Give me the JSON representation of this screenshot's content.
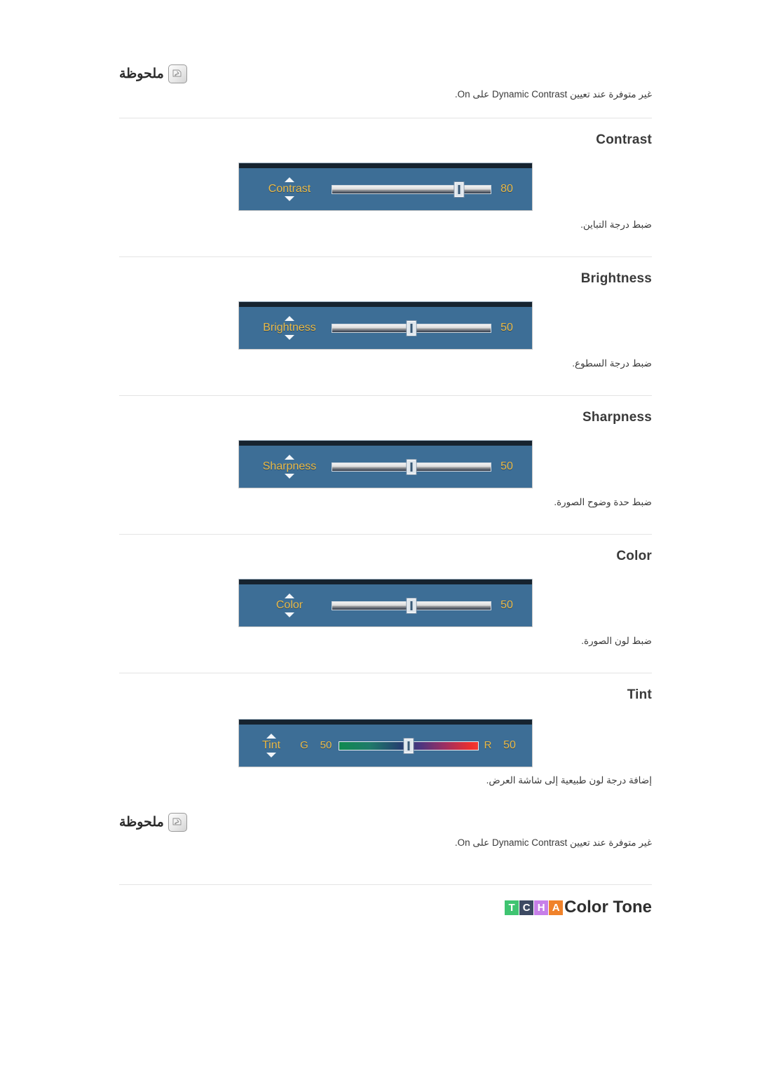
{
  "note_top": {
    "icon": "note-pencil-icon",
    "title": "ملحوظة",
    "body_prefix": ".",
    "body": "غير متوفرة عند تعيين Dynamic Contrast على On.",
    "emphasis": "Dynamic Contrast",
    "emphasis2": "On"
  },
  "sections": [
    {
      "heading": "Contrast",
      "osd": {
        "label": "Contrast",
        "value": "80",
        "thumb_percent": 80,
        "gradient": false,
        "left_text": "",
        "left_value": "",
        "right_text": "",
        "right_value": ""
      },
      "caption": "ضبط درجة التباين."
    },
    {
      "heading": "Brightness",
      "osd": {
        "label": "Brightness",
        "value": "50",
        "thumb_percent": 50,
        "gradient": false,
        "left_text": "",
        "left_value": "",
        "right_text": "",
        "right_value": ""
      },
      "caption": "ضبط درجة السطوع."
    },
    {
      "heading": "Sharpness",
      "osd": {
        "label": "Sharpness",
        "value": "50",
        "thumb_percent": 50,
        "gradient": false,
        "left_text": "",
        "left_value": "",
        "right_text": "",
        "right_value": ""
      },
      "caption": "ضبط حدة وضوح الصورة."
    },
    {
      "heading": "Color",
      "osd": {
        "label": "Color",
        "value": "50",
        "thumb_percent": 50,
        "gradient": false,
        "left_text": "",
        "left_value": "",
        "right_text": "",
        "right_value": ""
      },
      "caption": "ضبط لون الصورة."
    },
    {
      "heading": "Tint",
      "osd": {
        "label": "Tint",
        "value": "50",
        "thumb_percent": 50,
        "gradient": true,
        "left_text": "G",
        "left_value": "50",
        "right_text": "R",
        "right_value": "50"
      },
      "caption": "إضافة درجة لون طبيعية إلى شاشة العرض."
    }
  ],
  "note_bottom": {
    "icon": "note-pencil-icon",
    "title": "ملحوظة",
    "body": "غير متوفرة عند تعيين Dynamic Contrast على On.",
    "emphasis": "Dynamic Contrast",
    "emphasis2": "On"
  },
  "color_tone": {
    "title": "Color Tone",
    "badges": [
      {
        "letter": "T",
        "color": "#3fc471"
      },
      {
        "letter": "C",
        "color": "#3d4a63"
      },
      {
        "letter": "H",
        "color": "#c77fe8"
      },
      {
        "letter": "A",
        "color": "#f0822a"
      }
    ]
  },
  "theme": {
    "osd_bg": "#3d6e96",
    "osd_label": "#e8b949",
    "osd_topbar": "#16232f",
    "divider": "#e4e4e4",
    "heading": "#3a3a3a"
  }
}
